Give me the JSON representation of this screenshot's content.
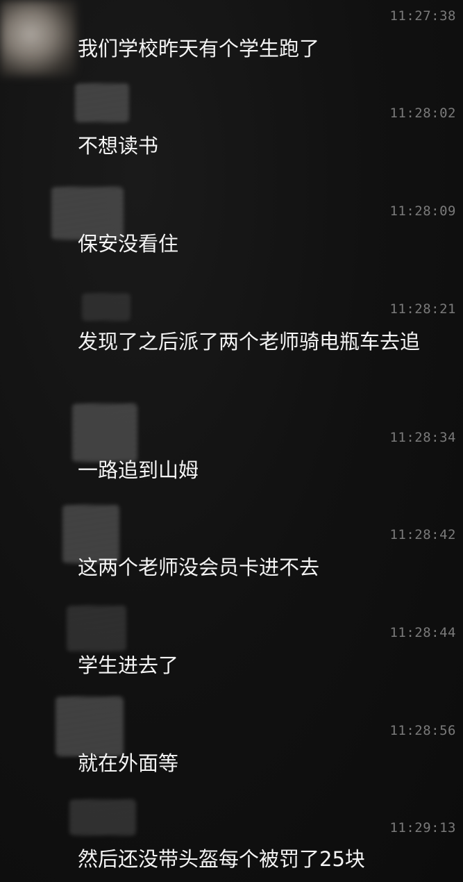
{
  "messages": [
    {
      "time": "11:27:38",
      "text": "我们学校昨天有个学生跑了"
    },
    {
      "time": "11:28:02",
      "text": "不想读书"
    },
    {
      "time": "11:28:09",
      "text": "保安没看住"
    },
    {
      "time": "11:28:21",
      "text": "发现了之后派了两个老师骑电瓶车去追"
    },
    {
      "time": "11:28:34",
      "text": "一路追到山姆"
    },
    {
      "time": "11:28:42",
      "text": "这两个老师没会员卡进不去"
    },
    {
      "time": "11:28:44",
      "text": "学生进去了"
    },
    {
      "time": "11:28:56",
      "text": "就在外面等"
    },
    {
      "time": "11:29:13",
      "text": "然后还没带头盔每个被罚了25块"
    }
  ]
}
